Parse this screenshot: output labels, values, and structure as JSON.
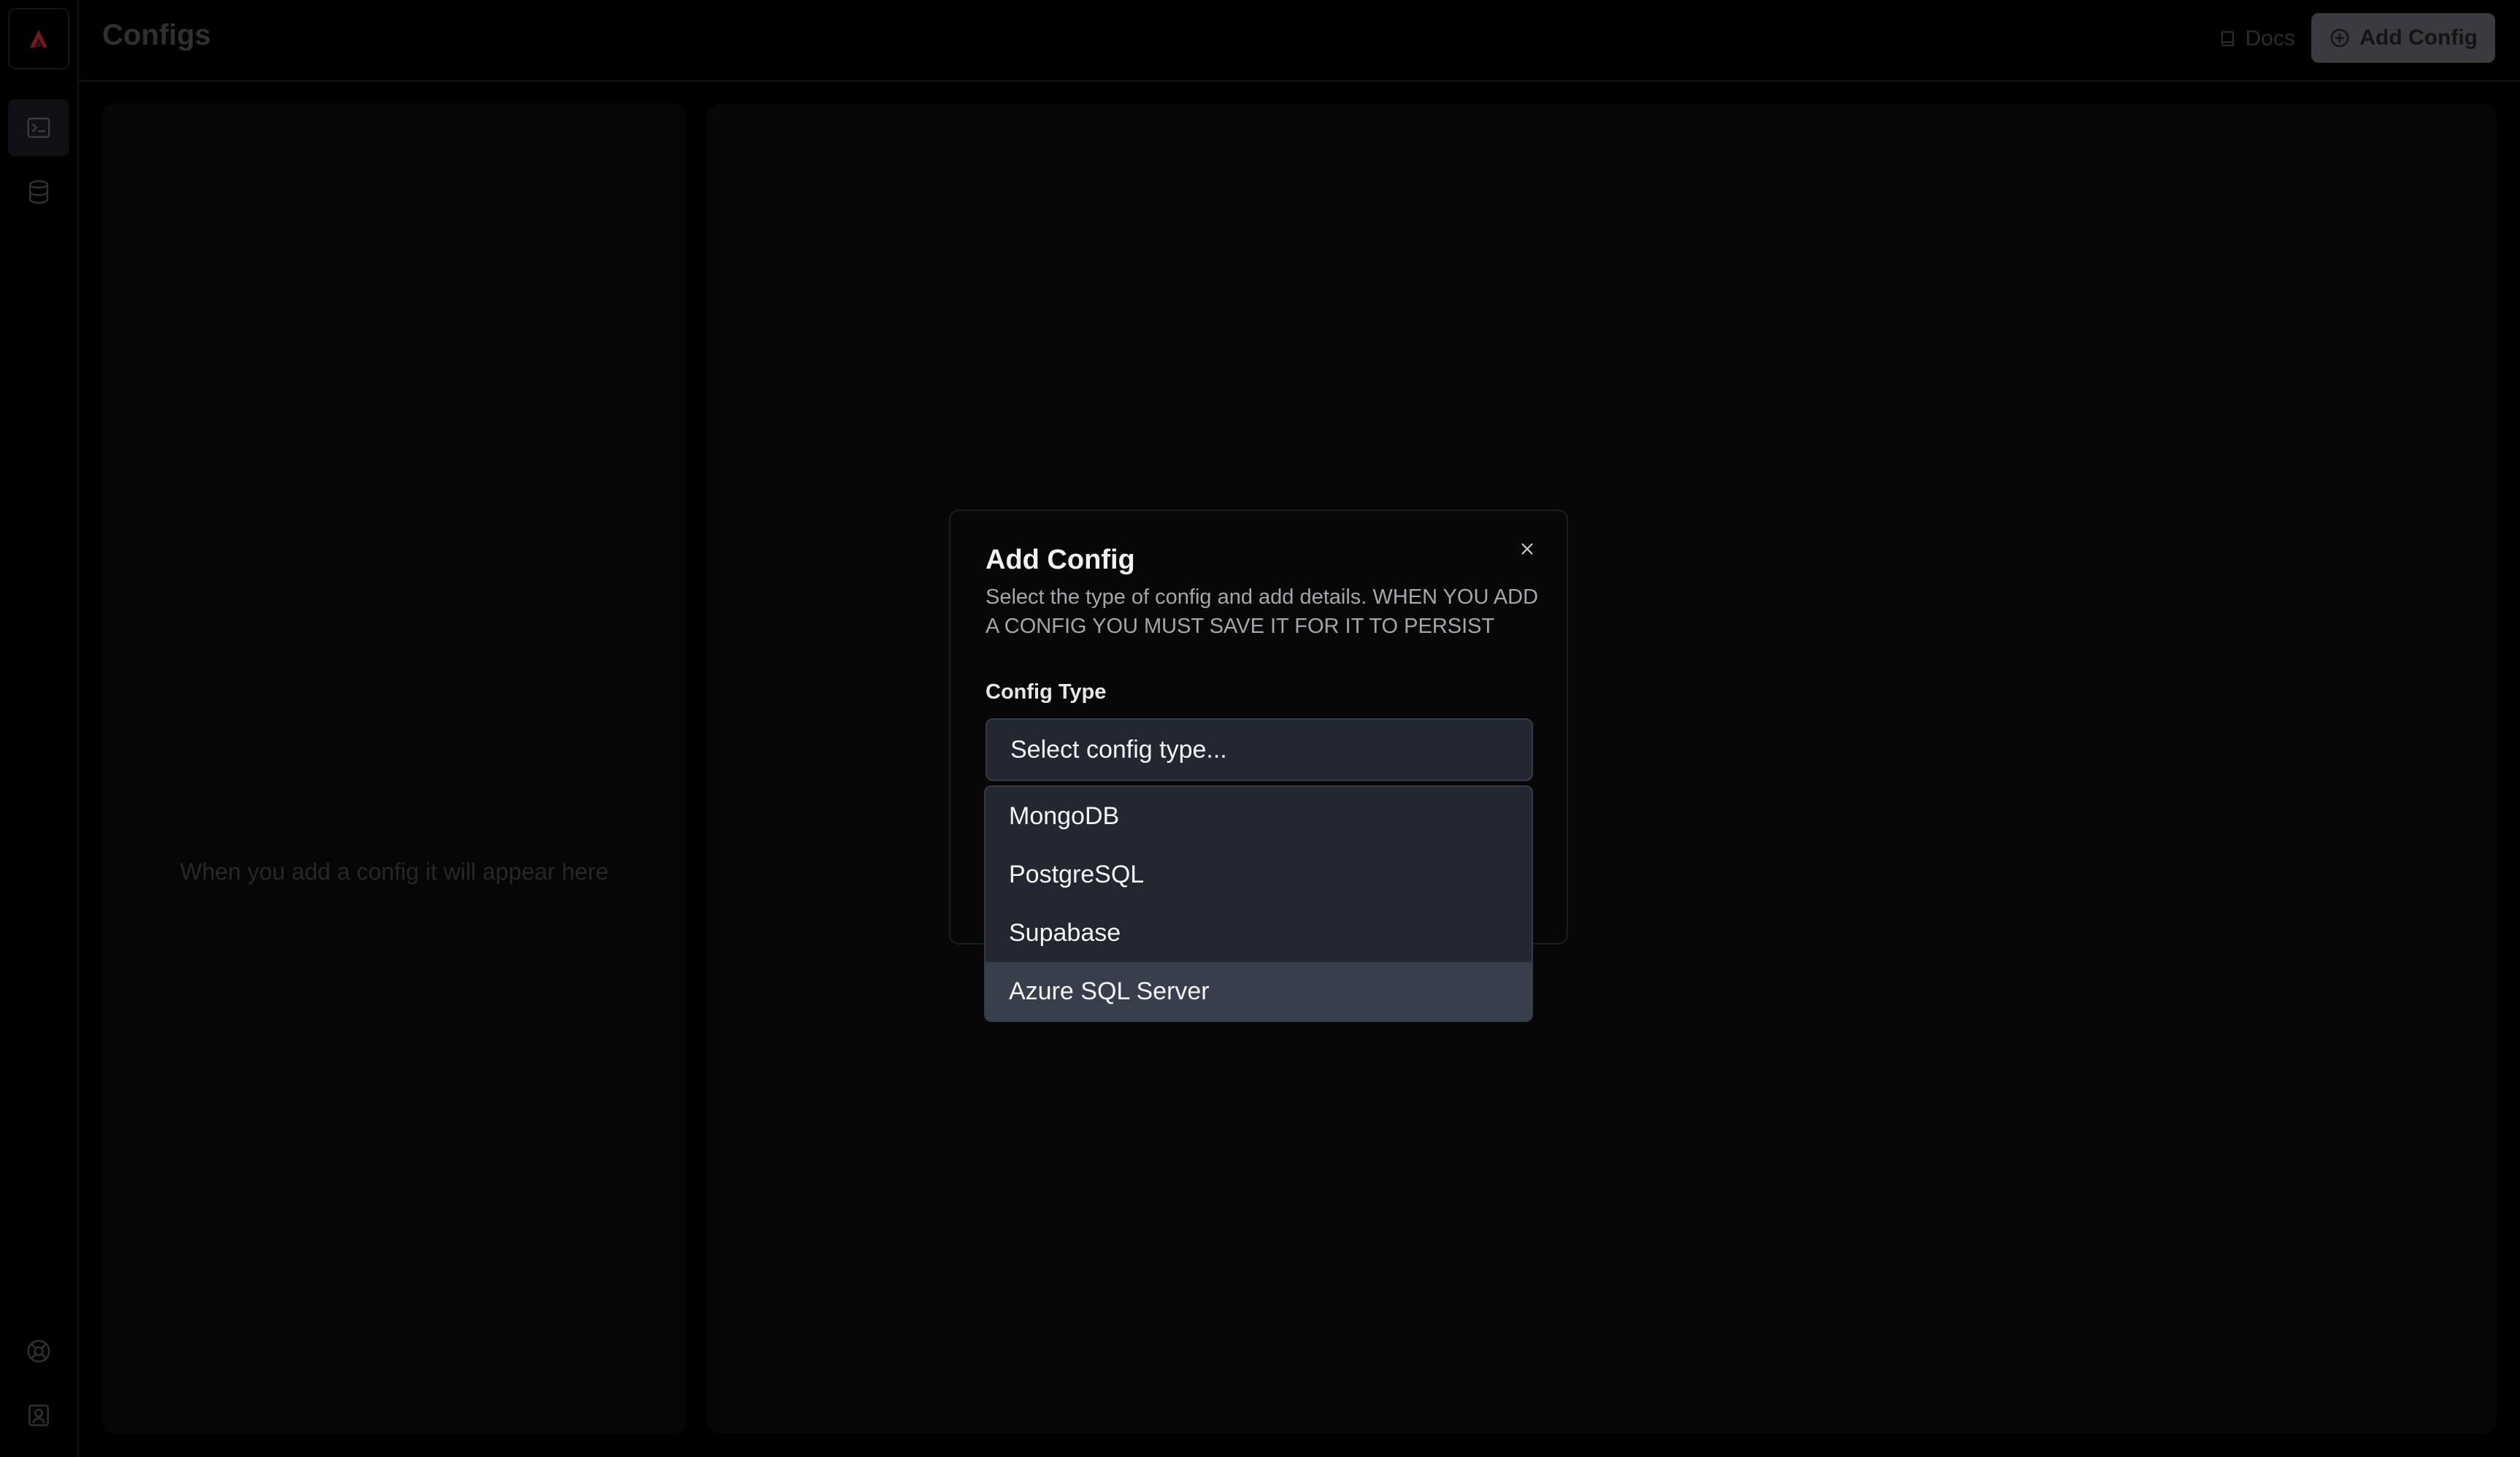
{
  "header": {
    "title": "Configs",
    "docs_label": "Docs",
    "add_config_label": "Add Config"
  },
  "sidebar": {
    "top_icons": [
      "terminal-icon",
      "database-icon"
    ],
    "bottom_icons": [
      "help-icon",
      "account-icon"
    ]
  },
  "list_panel": {
    "empty_text": "When you add a config it will appear here"
  },
  "modal": {
    "title": "Add Config",
    "description": "Select the type of config and add details. WHEN YOU ADD A CONFIG YOU MUST SAVE IT FOR IT TO PERSIST",
    "field_label": "Config Type",
    "select_placeholder": "Select config type...",
    "options": [
      "MongoDB",
      "PostgreSQL",
      "Supabase",
      "Azure SQL Server"
    ],
    "highlighted_option": "Azure SQL Server"
  },
  "colors": {
    "accent_logo": "#7a1f22",
    "select_bg": "#222731",
    "highlight_bg": "#383e4a"
  }
}
